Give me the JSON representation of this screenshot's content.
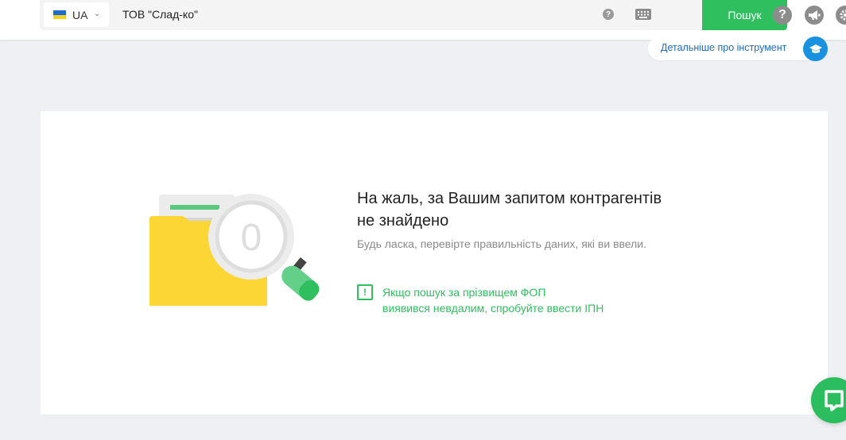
{
  "header": {
    "country_code": "UA",
    "query": "ТОВ \"Слад-ко\"",
    "search_button": "Пошук",
    "more_link": "Детальніше про інструмент"
  },
  "result": {
    "zero_count": "0",
    "title_line1": "На жаль, за Вашим запитом контрагентів",
    "title_line2": "не знайдено",
    "subtitle": "Будь ласка, перевірте правильність даних, які ви ввели.",
    "hint_line1": "Якщо пошук за прізвищем ФОП",
    "hint_line2": "виявився невдалим, спробуйте ввести ІПН"
  },
  "icons": {
    "help": "?",
    "hint_mark": "!"
  },
  "colors": {
    "accent_green": "#2fbf5f",
    "link_blue": "#1d6fc3",
    "folder_yellow": "#fbd634"
  }
}
